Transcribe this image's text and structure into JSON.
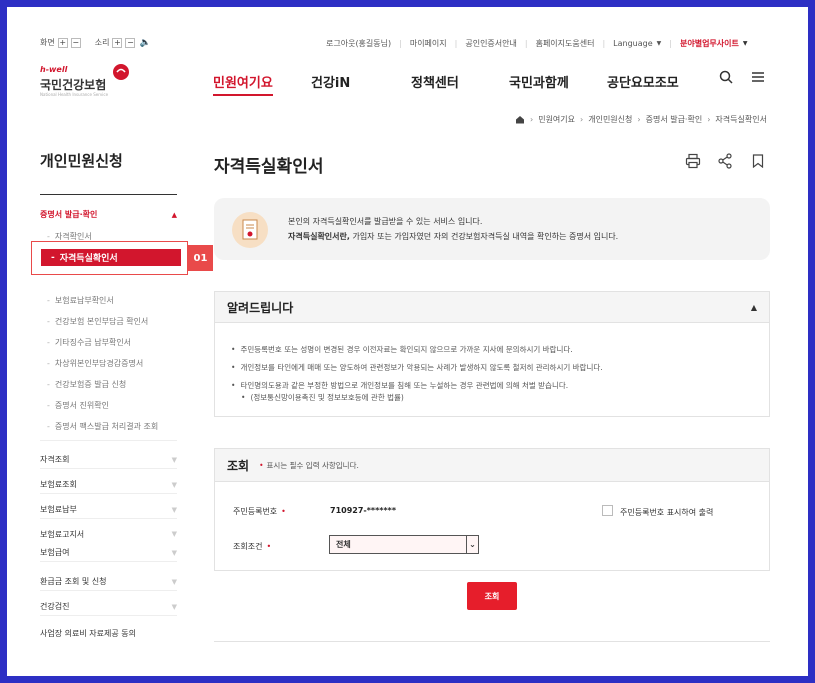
{
  "util": {
    "screen_label": "화면",
    "sound_label": "소리",
    "links": [
      "로그아웃(홍길동님)",
      "마이페이지",
      "공인인증서안내",
      "홈페이지도움센터",
      "Language"
    ],
    "related_site": "분야별업무사이트"
  },
  "logo": {
    "tagline": "h-well",
    "name": "국민건강보험"
  },
  "nav": [
    "민원여기요",
    "건강iN",
    "정책센터",
    "국민과함께",
    "공단요모조모"
  ],
  "breadcrumb": [
    "민원여기요",
    "개인민원신청",
    "증명서 발급·확인",
    "자격득실확인서"
  ],
  "sidebar": {
    "title": "개인민원신청",
    "section": "증명서 발급·확인",
    "sub_items": [
      "자격확인서",
      "자격득실확인서",
      "보험료납부확인서",
      "건강보험 본인부담금 확인서",
      "기타징수금 납부확인서",
      "차상위본인부담경감증명서",
      "건강보험증 발급 신청",
      "증명서 진위확인",
      "증명서 팩스발급 처리결과 조회"
    ],
    "callout_number": "01",
    "main_items": [
      "자격조회",
      "보험료조회",
      "보험료납부",
      "보험료고지서",
      "보험급여",
      "환급금 조회 및 신청",
      "건강검진",
      "사업장 의료비 자료제공 동의"
    ]
  },
  "page": {
    "title": "자격득실확인서",
    "intro_line1": "본인의 자격득실확인서를 발급받을 수 있는 서비스 입니다.",
    "intro_line2_bold": "자격득실확인서란,",
    "intro_line2": " 가입자 또는 가입자였던 자의 건강보험자격득실 내역을 확인하는 증명서 입니다."
  },
  "notice": {
    "title": "알려드립니다",
    "items": [
      "주민등록번호 또는 성명이 변경된 경우 이전자료는 확인되지 않으므로 가까운 지사에 문의하시기 바랍니다.",
      "개인정보를 타인에게 매매 또는 양도하여 관련정보가 악용되는 사례가 발생하지 않도록 철저히 관리하시기 바랍니다.",
      "타인명의도용과 같은 부정한 방법으로 개인정보를 침해 또는 누설하는 경우 관련법에 의해 처벌 받습니다.",
      "(정보통신망이용촉진 및 정보보호등에 관한 법률)"
    ]
  },
  "query": {
    "title": "조회",
    "required_note": "표시는 필수 입력 사항입니다.",
    "rrn_label": "주민등록번호",
    "rrn_value": "710927-*******",
    "rrn_print_label": "주민등록번호 표시하여 출력",
    "condition_label": "조회조건",
    "condition_value": "전체",
    "submit": "조회"
  },
  "colors": {
    "accent": "#d2162d",
    "frame": "#2d2fc4"
  }
}
